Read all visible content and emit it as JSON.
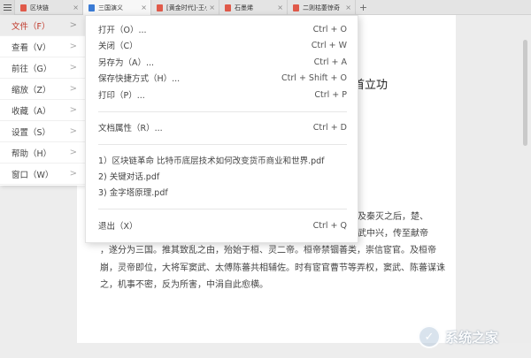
{
  "tabs": [
    {
      "label": "区块链",
      "type": "pdf",
      "active": false
    },
    {
      "label": "三国演义",
      "type": "doc",
      "active": true
    },
    {
      "label": "[黄金时代]-王小波",
      "type": "pdf",
      "active": false
    },
    {
      "label": "石墨烯",
      "type": "pdf",
      "active": false
    },
    {
      "label": "二则枯萎惊奇",
      "type": "pdf",
      "active": false
    }
  ],
  "tab_close_glyph": "×",
  "tab_add_glyph": "+",
  "document": {
    "title_fragment": "首立功",
    "paragraph_line1_fragment": "及秦灭之后，楚、",
    "paragraph_line2_fragment": "武中兴，传至献帝",
    "paragraph_rest": "，遂分为三国。推其致乱之由，殆始于桓、灵二帝。桓帝禁锢善类，崇信宦官。及桓帝崩，灵帝即位，大将军窦武、太傅陈蕃共相辅佐。时有宦官曹节等弄权，窦武、陈蕃谋诛之，机事不密，反为所害，中涓自此愈横。"
  },
  "menu": {
    "items": [
      {
        "label": "文件（F）",
        "active": true
      },
      {
        "label": "查看（V）",
        "active": false
      },
      {
        "label": "前往（G）",
        "active": false
      },
      {
        "label": "缩放（Z）",
        "active": false
      },
      {
        "label": "收藏（A）",
        "active": false
      },
      {
        "label": "设置（S）",
        "active": false
      },
      {
        "label": "帮助（H）",
        "active": false
      },
      {
        "label": "窗口（W）",
        "active": false
      }
    ],
    "chevron": ">"
  },
  "submenu": {
    "open": {
      "label": "打开（O）...",
      "shortcut": "Ctrl + O"
    },
    "close": {
      "label": "关闭（C）",
      "shortcut": "Ctrl + W"
    },
    "save_as": {
      "label": "另存为（A）...",
      "shortcut": "Ctrl + A"
    },
    "save_shortcut": {
      "label": "保存快捷方式（H）...",
      "shortcut": "Ctrl + Shift + O"
    },
    "print": {
      "label": "打印（P）...",
      "shortcut": "Ctrl + P"
    },
    "properties": {
      "label": "文档属性（R）...",
      "shortcut": "Ctrl + D"
    },
    "recent": [
      "1）区块链革命 比特币底层技术如何改变货币商业和世界.pdf",
      "2) 关键对话.pdf",
      "3) 金字塔原理.pdf"
    ],
    "exit": {
      "label": "退出（X）",
      "shortcut": "Ctrl + Q"
    }
  },
  "watermark": {
    "text": "系统之家"
  },
  "colors": {
    "accent_red": "#c0392b",
    "pdf_icon": "#e05a4a",
    "doc_icon": "#3a7bd5"
  }
}
